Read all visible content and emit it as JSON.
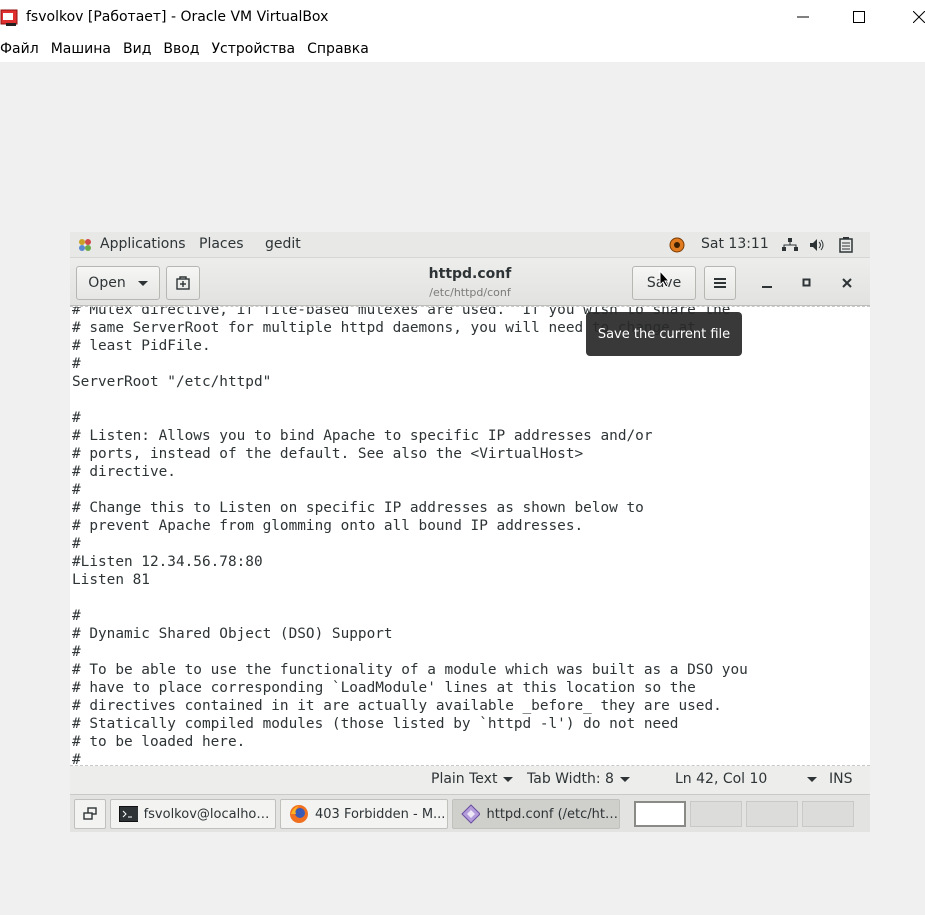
{
  "host": {
    "title": "fsvolkov [Работает] - Oracle VM VirtualBox",
    "menu": [
      "Файл",
      "Машина",
      "Вид",
      "Ввод",
      "Устройства",
      "Справка"
    ]
  },
  "topbar": {
    "applications": "Applications",
    "places": "Places",
    "app": "gedit",
    "clock": "Sat 13:11"
  },
  "headerbar": {
    "open_label": "Open",
    "title": "httpd.conf",
    "subtitle": "/etc/httpd/conf",
    "save_label": "Save"
  },
  "tooltip": "Save the current file",
  "editor": {
    "lines": [
      "# Mutex directive, if file-based mutexes are used.  If you wish to share the",
      "# same ServerRoot for multiple httpd daemons, you will need to change at",
      "# least PidFile.",
      "#",
      "ServerRoot \"/etc/httpd\"",
      "",
      "#",
      "# Listen: Allows you to bind Apache to specific IP addresses and/or",
      "# ports, instead of the default. See also the <VirtualHost>",
      "# directive.",
      "#",
      "# Change this to Listen on specific IP addresses as shown below to",
      "# prevent Apache from glomming onto all bound IP addresses.",
      "#",
      "#Listen 12.34.56.78:80",
      "Listen 81",
      "",
      "#",
      "# Dynamic Shared Object (DSO) Support",
      "#",
      "# To be able to use the functionality of a module which was built as a DSO you",
      "# have to place corresponding `LoadModule' lines at this location so the",
      "# directives contained in it are actually available _before_ they are used.",
      "# Statically compiled modules (those listed by `httpd -l') do not need",
      "# to be loaded here.",
      "#"
    ]
  },
  "statusbar": {
    "syntax": "Plain Text",
    "tab_width": "Tab Width: 8",
    "position": "Ln 42, Col 10",
    "mode": "INS"
  },
  "taskbar": {
    "tasks": [
      "fsvolkov@localhost:...",
      "403 Forbidden - M...",
      "httpd.conf (/etc/htt..."
    ]
  },
  "colors": {
    "accent": "#cc3333",
    "tooltip_bg": "#282828"
  }
}
